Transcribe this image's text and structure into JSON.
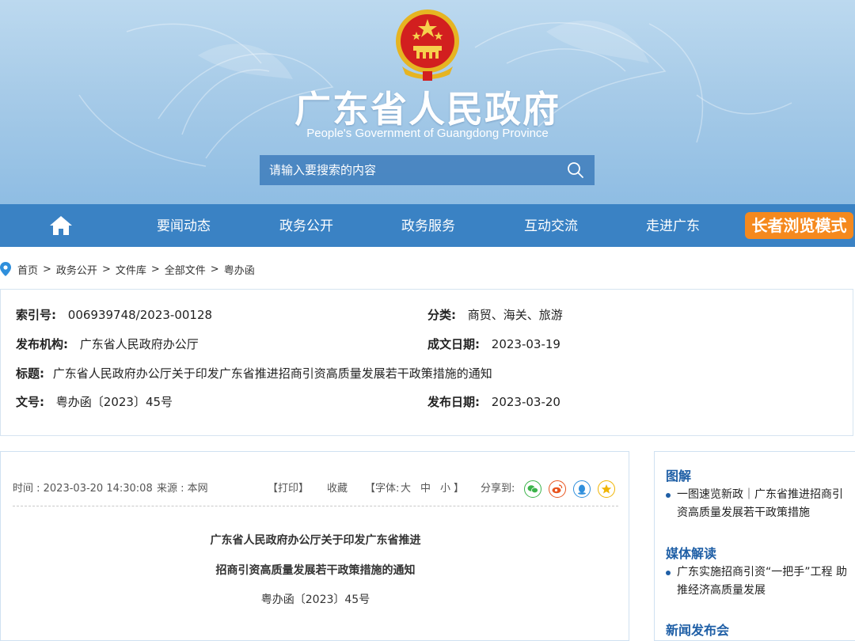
{
  "header": {
    "title": "广东省人民政府",
    "subtitle": "People's Government of Guangdong Province",
    "search_placeholder": "请输入要搜索的内容"
  },
  "nav": {
    "items": [
      "要闻动态",
      "政务公开",
      "政务服务",
      "互动交流",
      "走进广东"
    ],
    "elder_mode": "长者浏览模式"
  },
  "breadcrumb": [
    "首页",
    "政务公开",
    "文件库",
    "全部文件",
    "粤办函"
  ],
  "breadcrumb_sep": ">",
  "info": {
    "index_label": "索引号:",
    "index_value": "006939748/2023-00128",
    "category_label": "分类:",
    "category_value": "商贸、海关、旅游",
    "issuer_label": "发布机构:",
    "issuer_value": "广东省人民政府办公厅",
    "written_label": "成文日期:",
    "written_value": "2023-03-19",
    "title_label": "标题:",
    "title_value": "广东省人民政府办公厅关于印发广东省推进招商引资高质量发展若干政策措施的通知",
    "docno_label": "文号:",
    "docno_value": "粤办函〔2023〕45号",
    "publish_label": "发布日期:",
    "publish_value": "2023-03-20"
  },
  "article": {
    "time": "时间 : 2023-03-20 14:30:08",
    "source": "来源 : 本网",
    "print": "【打印】",
    "favorite": "收藏",
    "font_label": "【字体:",
    "font_large": "大",
    "font_medium": "中",
    "font_small": "小",
    "font_close": "】",
    "share_label": "分享到:",
    "title_line1": "广东省人民政府办公厅关于印发广东省推进",
    "title_line2": "招商引资高质量发展若干政策措施的通知",
    "doc_number": "粤办函〔2023〕45号"
  },
  "sidebar": {
    "sections": [
      {
        "heading": "图解",
        "item": "一图速览新政｜广东省推进招商引资高质量发展若干政策措施"
      },
      {
        "heading": "媒体解读",
        "item": "广东实施招商引资“一把手”工程 助推经济高质量发展"
      },
      {
        "heading": "新闻发布会",
        "item": ""
      }
    ]
  },
  "colors": {
    "nav_bg": "#3a82c4",
    "elder_btn": "#f5891e",
    "side_heading": "#1f5fa6",
    "wechat": "#3bb34a",
    "weibo": "#e8541e",
    "qq": "#2f8fdc",
    "qzone": "#f0b400"
  }
}
